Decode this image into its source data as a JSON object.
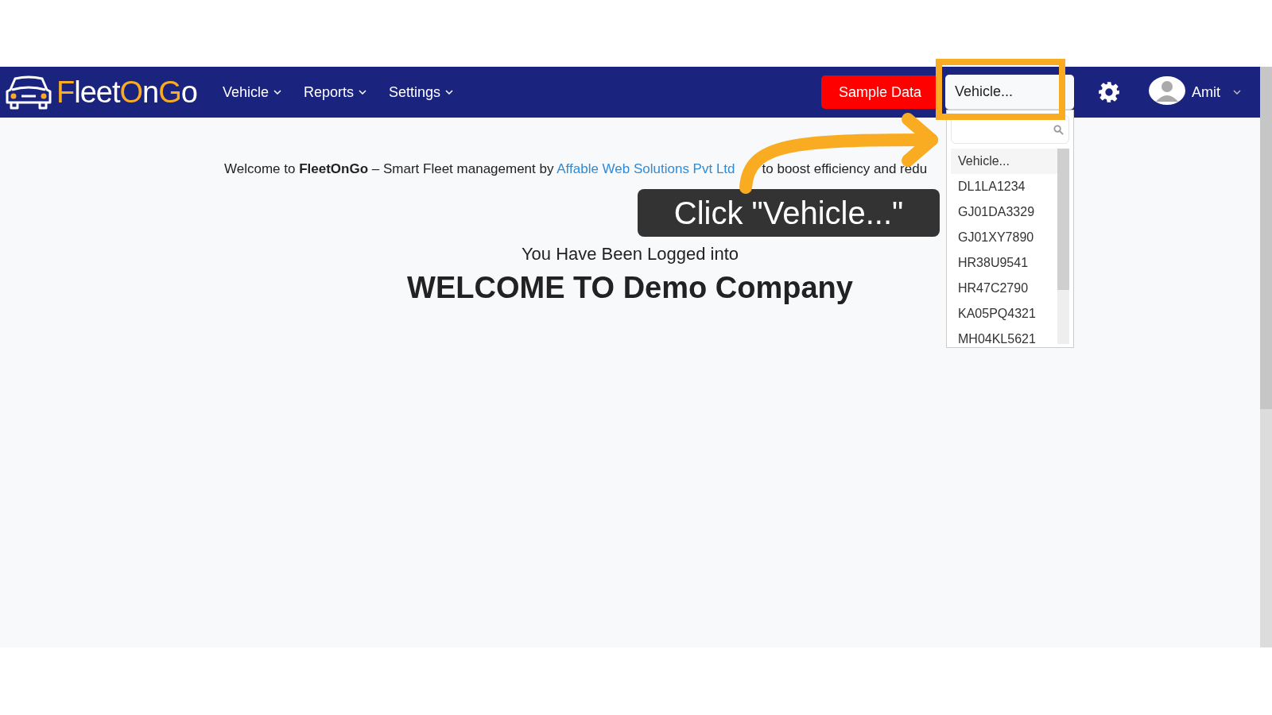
{
  "navbar": {
    "logo": {
      "parts": [
        {
          "text": "F",
          "accent": true
        },
        {
          "text": "leet",
          "accent": false
        },
        {
          "text": "O",
          "accent": true
        },
        {
          "text": "n",
          "accent": false
        },
        {
          "text": "G",
          "accent": true
        },
        {
          "text": "o",
          "accent": false
        }
      ]
    },
    "menu": [
      {
        "label": "Vehicle"
      },
      {
        "label": "Reports"
      },
      {
        "label": "Settings"
      }
    ],
    "sample_button": "Sample Data",
    "vehicle_select": {
      "value": "Vehicle...",
      "expanded": true
    },
    "user": {
      "name": "Amit"
    }
  },
  "dropdown": {
    "options": [
      {
        "label": "Vehicle...",
        "selected": true
      },
      {
        "label": "DL1LA1234",
        "selected": false
      },
      {
        "label": "GJ01DA3329",
        "selected": false
      },
      {
        "label": "GJ01XY7890",
        "selected": false
      },
      {
        "label": "HR38U9541",
        "selected": false
      },
      {
        "label": "HR47C2790",
        "selected": false
      },
      {
        "label": "KA05PQ4321",
        "selected": false
      },
      {
        "label": "MH04KL5621",
        "selected": false
      }
    ]
  },
  "content": {
    "intro": {
      "before": "Welcome to **FleetOnGo** – Smart Fleet management by",
      "link": "Affable Web Solutions Pvt Ltd",
      "after": "to boost efficiency and redu"
    },
    "logged_in": "You Have Been Logged into",
    "heading": "WELCOME TO Demo Company"
  },
  "callout": {
    "text": "Click \"Vehicle...\""
  }
}
